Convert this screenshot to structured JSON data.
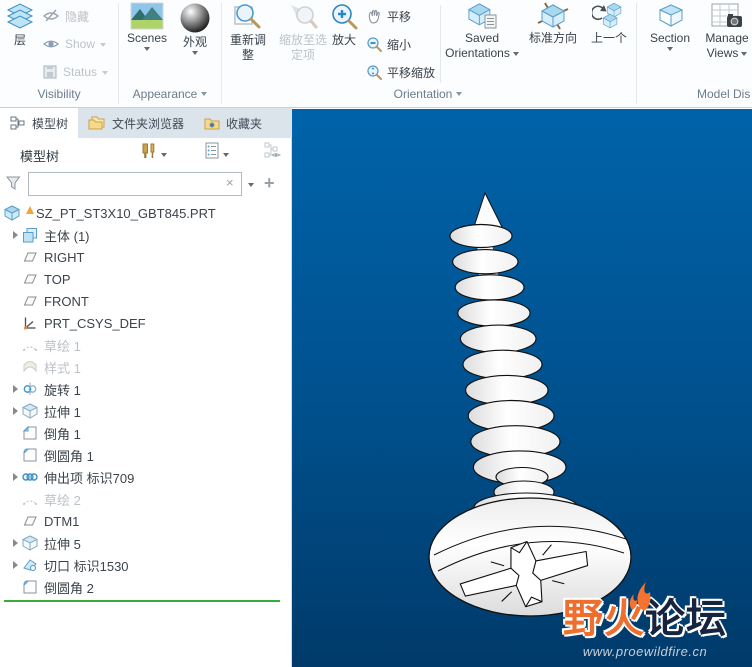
{
  "ribbon": {
    "visibility": {
      "layers": "层",
      "hide": "隐藏",
      "show": "Show",
      "status": "Status",
      "group": "Visibility"
    },
    "appearance": {
      "scenes": "Scenes",
      "appearance": "外观",
      "group": "Appearance"
    },
    "orientation": {
      "refit_l1": "重新调",
      "refit_l2": "整",
      "zoomsel_l1": "缩放至选",
      "zoomsel_l2": "定项",
      "zoomin": "放大",
      "pan": "平移",
      "zoomout": "缩小",
      "panzoom": "平移缩放",
      "saved_l1": "Saved",
      "saved_l2": "Orientations",
      "standard": "标准方向",
      "previous": "上一个",
      "group": "Orientation"
    },
    "model_display": {
      "section": "Section",
      "manage_l1": "Manage",
      "manage_l2": "Views",
      "group": "Model Dis"
    }
  },
  "panel": {
    "tabs": [
      {
        "label": "模型树"
      },
      {
        "label": "文件夹浏览器"
      },
      {
        "label": "收藏夹"
      }
    ],
    "header": "模型树",
    "filter_value": "",
    "tree": [
      {
        "label": "SZ_PT_ST3X10_GBT845.PRT",
        "icon": "part",
        "warning": true,
        "root": true
      },
      {
        "label": "主体 (1)",
        "icon": "body",
        "arrow": true
      },
      {
        "label": "RIGHT",
        "icon": "plane"
      },
      {
        "label": "TOP",
        "icon": "plane"
      },
      {
        "label": "FRONT",
        "icon": "plane"
      },
      {
        "label": "PRT_CSYS_DEF",
        "icon": "csys"
      },
      {
        "label": "草绘 1",
        "icon": "sketch",
        "disabled": true
      },
      {
        "label": "样式 1",
        "icon": "style",
        "disabled": true
      },
      {
        "label": "旋转 1",
        "icon": "revolve",
        "arrow": true
      },
      {
        "label": "拉伸 1",
        "icon": "extrude",
        "arrow": true
      },
      {
        "label": "倒角 1",
        "icon": "chamfer"
      },
      {
        "label": "倒圆角 1",
        "icon": "round"
      },
      {
        "label": "伸出项 标识709",
        "icon": "coil",
        "arrow": true
      },
      {
        "label": "草绘 2",
        "icon": "sketch",
        "disabled": true
      },
      {
        "label": "DTM1",
        "icon": "plane"
      },
      {
        "label": "拉伸 5",
        "icon": "extrude",
        "arrow": true
      },
      {
        "label": "切口 标识1530",
        "icon": "cut",
        "arrow": true
      },
      {
        "label": "倒圆角 2",
        "icon": "round"
      }
    ]
  },
  "viewport": {
    "bg_top": "#0063a9",
    "bg_bottom": "#003a6a",
    "watermark": {
      "orange": "野火",
      "dark": "论坛",
      "url": "www.proewildfire.cn",
      "accent": "#ee6f2d"
    }
  }
}
